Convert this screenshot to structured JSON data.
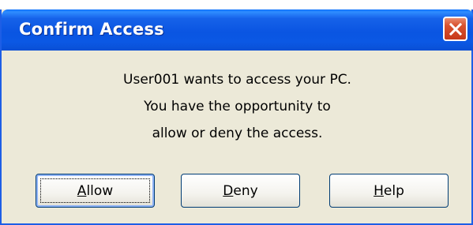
{
  "window": {
    "title": "Confirm Access",
    "accent_color": "#0a55e2",
    "close_icon": "close-icon"
  },
  "message": {
    "lines": [
      "User001 wants to access your PC.",
      "You have the opportunity to",
      "allow or deny the access."
    ]
  },
  "buttons": {
    "allow": {
      "accel": "A",
      "rest": "llow"
    },
    "deny": {
      "accel": "D",
      "rest": "eny"
    },
    "help": {
      "accel": "H",
      "rest": "elp"
    }
  }
}
